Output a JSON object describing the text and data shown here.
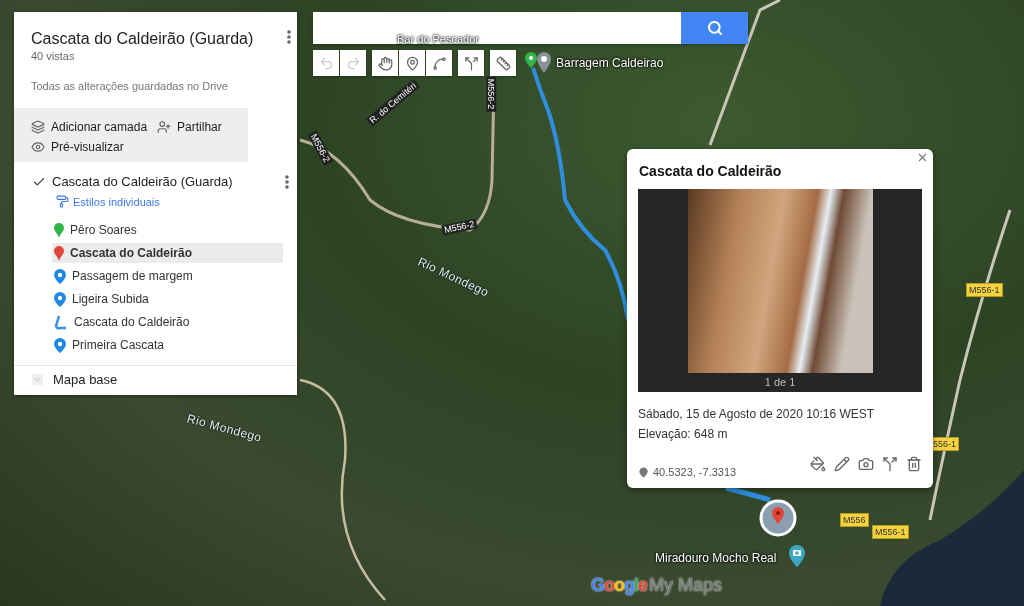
{
  "panel": {
    "title": "Cascata do Caldeirão (Guarda)",
    "views": "40 vistas",
    "save_status": "Todas as alterações guardadas no Drive",
    "actions": [
      {
        "kind": "layer",
        "label": "Adicionar camada"
      },
      {
        "kind": "share",
        "label": "Partilhar"
      },
      {
        "kind": "preview",
        "label": "Pré-visualizar"
      }
    ],
    "layer": {
      "title": "Cascata do Caldeirão (Guarda)",
      "checked": true,
      "style_link": "Estilos individuais",
      "items": [
        {
          "kind": "pin",
          "color": "#2fb54a",
          "label": "Pêro Soares",
          "selected": false
        },
        {
          "kind": "pin",
          "color": "#e0463a",
          "label": "Cascata do Caldeirão",
          "selected": true
        },
        {
          "kind": "drop",
          "color": "#1e88e5",
          "label": "Passagem de margem",
          "selected": false
        },
        {
          "kind": "drop",
          "color": "#1e88e5",
          "label": "Ligeira Subida",
          "selected": false
        },
        {
          "kind": "line",
          "color": "#3d8fe0",
          "label": "Cascata do Caldeirão",
          "selected": false
        },
        {
          "kind": "drop",
          "color": "#1e88e5",
          "label": "Primeira Cascata",
          "selected": false
        }
      ]
    },
    "base_map": {
      "label": "Mapa base"
    }
  },
  "toolbar": [
    {
      "kind": "undo",
      "disabled": true
    },
    {
      "kind": "redo",
      "disabled": true
    },
    {
      "kind": "hand",
      "disabled": false
    },
    {
      "kind": "marker",
      "disabled": false
    },
    {
      "kind": "line",
      "disabled": false
    },
    {
      "kind": "directions",
      "disabled": false
    },
    {
      "kind": "ruler",
      "disabled": false
    }
  ],
  "map_labels": [
    {
      "kind": "place",
      "text": "Bar do Pescador"
    },
    {
      "kind": "place",
      "text": "Barragem Caldeirao"
    },
    {
      "kind": "street",
      "text": "R. do Cemitéri"
    },
    {
      "kind": "street",
      "text": "M556-2"
    },
    {
      "kind": "street",
      "text": "M556-2"
    },
    {
      "kind": "street",
      "text": "M556-2"
    },
    {
      "kind": "river",
      "text": "Rio Mondego"
    },
    {
      "kind": "river",
      "text": "Rio Mondego"
    },
    {
      "kind": "tag",
      "text": "M556-1"
    },
    {
      "kind": "tag",
      "text": "556-1"
    },
    {
      "kind": "tag",
      "text": "M556"
    },
    {
      "kind": "tag",
      "text": "M556-1"
    },
    {
      "kind": "place",
      "text": "Miradouro Mocho Real"
    }
  ],
  "popup": {
    "title": "Cascata do Caldeirão",
    "photo_counter": "1 de 1",
    "date": "Sábado, 15 de Agosto de 2020 10:16 WEST",
    "elevation": "Elevação: 648 m",
    "coordinates": "40.5323, -7.3313"
  },
  "logo": {
    "brand": "Google",
    "product": "My Maps"
  }
}
